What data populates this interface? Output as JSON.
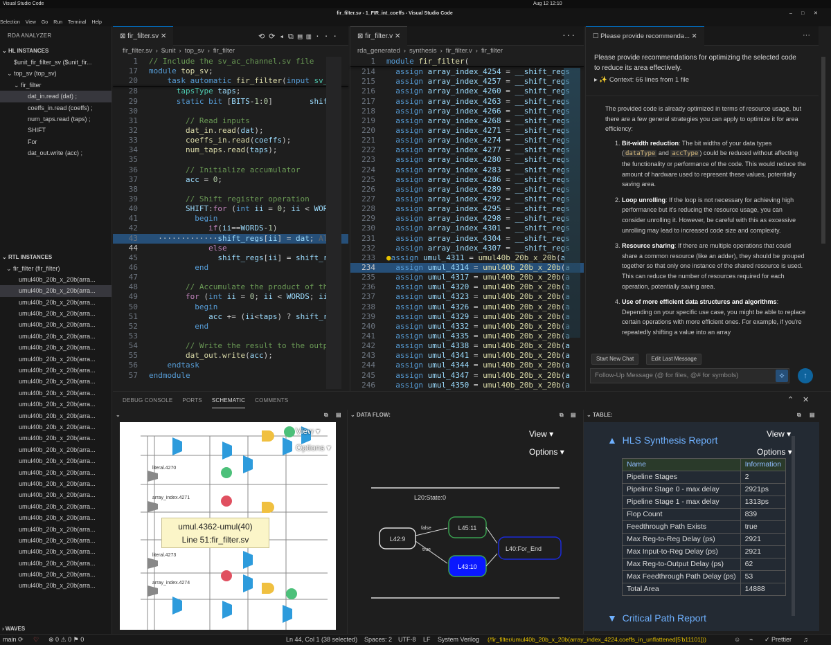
{
  "system_bar": {
    "app": "Visual Studio Code",
    "datetime": "Aug 12  12:10"
  },
  "window": {
    "title": "fir_filter.sv - 1_FIR_int_coeffs - Visual Studio Code"
  },
  "menu": [
    "Selection",
    "View",
    "Go",
    "Run",
    "Terminal",
    "Help"
  ],
  "sidebar": {
    "title": "RDA ANALYZER",
    "hl_section": "HL INSTANCES",
    "hl_items": [
      {
        "label": "$unit_fir_filter_sv ($unit_fir...",
        "indent": 1
      },
      {
        "label": "top_sv (top_sv)",
        "indent": 1
      },
      {
        "label": "fir_filter",
        "indent": 2
      },
      {
        "label": "dat_in.read (dat) ;",
        "indent": 3,
        "selected": true
      },
      {
        "label": "coeffs_in.read (coeffs) ;",
        "indent": 3
      },
      {
        "label": "num_taps.read (taps) ;",
        "indent": 3
      },
      {
        "label": "SHIFT",
        "indent": 3
      },
      {
        "label": "For",
        "indent": 3
      },
      {
        "label": "dat_out.write (acc) ;",
        "indent": 3
      }
    ],
    "rtl_section": "RTL INSTANCES",
    "rtl_root": "fir_filter (fir_filter)",
    "rtl_items": [
      "umul40b_20b_x_20b(arra...",
      "umul40b_20b_x_20b(arra...",
      "umul40b_20b_x_20b(arra...",
      "umul40b_20b_x_20b(arra...",
      "umul40b_20b_x_20b(arra...",
      "umul40b_20b_x_20b(arra...",
      "umul40b_20b_x_20b(arra...",
      "umul40b_20b_x_20b(arra...",
      "umul40b_20b_x_20b(arra...",
      "umul40b_20b_x_20b(arra...",
      "umul40b_20b_x_20b(arra...",
      "umul40b_20b_x_20b(arra...",
      "umul40b_20b_x_20b(arra...",
      "umul40b_20b_x_20b(arra...",
      "umul40b_20b_x_20b(arra...",
      "umul40b_20b_x_20b(arra...",
      "umul40b_20b_x_20b(arra...",
      "umul40b_20b_x_20b(arra...",
      "umul40b_20b_x_20b(arra...",
      "umul40b_20b_x_20b(arra...",
      "umul40b_20b_x_20b(arra...",
      "umul40b_20b_x_20b(arra...",
      "umul40b_20b_x_20b(arra...",
      "umul40b_20b_x_20b(arra...",
      "umul40b_20b_x_20b(arra...",
      "umul40b_20b_x_20b(arra...",
      "umul40b_20b_x_20b(arra...",
      "umul40b_20b_x_20b(arra..."
    ],
    "rtl_selected_index": 1,
    "waves": "WAVES"
  },
  "editor1": {
    "tab": "fir_filter.sv",
    "breadcrumb": [
      "fir_filter.sv",
      "$unit",
      "top_sv",
      "fir_filter"
    ],
    "sticky": [
      {
        "n": "1",
        "html": "<span class='cm'>// Include the sv_ac_channel.sv file</span>"
      },
      {
        "n": "17",
        "html": "<span class='kw'>module</span> <span class='fn'>top_sv</span>;"
      },
      {
        "n": "20",
        "html": "    <span class='kw'>task</span> <span class='kw'>automatic</span> <span class='fn'>fir_filter</span>(<span class='kw'>input</span> <span class='ty'>sv_ac</span>"
      }
    ],
    "lines": [
      {
        "n": "28",
        "html": "      <span class='ty'>tapsType</span> <span class='id'>taps</span>;"
      },
      {
        "n": "29",
        "html": "      <span class='kw'>static</span> <span class='kw'>bit</span> [<span class='id'>BITS</span>-<span class='nm'>1</span>:<span class='nm'>0</span>]        <span class='id'>shift_</span>"
      },
      {
        "n": "30",
        "html": ""
      },
      {
        "n": "31",
        "html": "        <span class='cm'>// Read inputs</span>"
      },
      {
        "n": "32",
        "html": "        <span class='fn'>dat_in</span>.<span class='fn'>read</span>(<span class='id'>dat</span>);"
      },
      {
        "n": "33",
        "html": "        <span class='fn'>coeffs_in</span>.<span class='fn'>read</span>(<span class='id'>coeffs</span>);"
      },
      {
        "n": "34",
        "html": "        <span class='fn'>num_taps</span>.<span class='fn'>read</span>(<span class='id'>taps</span>);"
      },
      {
        "n": "35",
        "html": ""
      },
      {
        "n": "36",
        "html": "        <span class='cm'>// Initialize accumulator</span>"
      },
      {
        "n": "37",
        "html": "        <span class='id'>acc</span> = <span class='nm'>0</span>;"
      },
      {
        "n": "38",
        "html": ""
      },
      {
        "n": "39",
        "html": "        <span class='cm'>// Shift register operation</span>"
      },
      {
        "n": "40",
        "html": "        <span class='id'>SHIFT</span>:<span class='pk'>for</span> (<span class='kw'>int</span> <span class='id'>ii</span> = <span class='nm'>0</span>; <span class='id'>ii</span> &lt; <span class='id'>WORD</span>"
      },
      {
        "n": "41",
        "html": "          <span class='kw'>begin</span>"
      },
      {
        "n": "42",
        "html": "             <span class='pk'>if</span>(<span class='id'>ii</span>==<span class='id'>WORDS</span>-<span class='nm'>1</span>)"
      },
      {
        "n": "43",
        "html": "  ·············<span class='id'>shift_regs</span>[<span class='id'>ii</span>] = <span class='id'>dat</span>; <span style='color:#666'>Al</span>",
        "hl": true
      },
      {
        "n": "44",
        "html": "             <span class='pk'>else</span>",
        "cur": true
      },
      {
        "n": "45",
        "html": "               <span class='id'>shift_regs</span>[<span class='id'>ii</span>] = <span class='id'>shift_re</span>"
      },
      {
        "n": "46",
        "html": "          <span class='kw'>end</span>"
      },
      {
        "n": "47",
        "html": ""
      },
      {
        "n": "48",
        "html": "        <span class='cm'>// Accumulate the product of th</span>"
      },
      {
        "n": "49",
        "html": "        <span class='pk'>for</span> (<span class='kw'>int</span> <span class='id'>ii</span> = <span class='nm'>0</span>; <span class='id'>ii</span> &lt; <span class='id'>WORDS</span>; <span class='id'>ii</span>-"
      },
      {
        "n": "50",
        "html": "          <span class='kw'>begin</span>"
      },
      {
        "n": "51",
        "html": "             <span class='id'>acc</span> += (<span class='id'>ii</span>&lt;<span class='id'>taps</span>) ? <span class='id'>shift_re</span>"
      },
      {
        "n": "52",
        "html": "          <span class='kw'>end</span>"
      },
      {
        "n": "53",
        "html": ""
      },
      {
        "n": "54",
        "html": "        <span class='cm'>// Write the result to the outpu</span>"
      },
      {
        "n": "55",
        "html": "        <span class='fn'>dat_out</span>.<span class='fn'>write</span>(<span class='id'>acc</span>);"
      },
      {
        "n": "56",
        "html": "    <span class='kw'>endtask</span>"
      },
      {
        "n": "57",
        "html": "<span class='kw'>endmodule</span>"
      }
    ]
  },
  "editor2": {
    "tab": "fir_filter.v",
    "breadcrumb": [
      "rda_generated",
      "synthesis",
      "fir_filter.v",
      "fir_filter"
    ],
    "sticky": {
      "n": "1",
      "html": "<span class='kw'>module</span> <span class='fn'>fir_filter</span>("
    },
    "lines": [
      {
        "n": "214",
        "html": "  <span class='kw'>assign</span> <span class='id'>array_index_4254</span> = <span class='id'>__shift_regs</span>"
      },
      {
        "n": "215",
        "html": "  <span class='kw'>assign</span> <span class='id'>array_index_4257</span> = <span class='id'>__shift_regs</span>"
      },
      {
        "n": "216",
        "html": "  <span class='kw'>assign</span> <span class='id'>array_index_4260</span> = <span class='id'>__shift_regs</span>"
      },
      {
        "n": "217",
        "html": "  <span class='kw'>assign</span> <span class='id'>array_index_4263</span> = <span class='id'>__shift_regs</span>"
      },
      {
        "n": "218",
        "html": "  <span class='kw'>assign</span> <span class='id'>array_index_4266</span> = <span class='id'>__shift_regs</span>"
      },
      {
        "n": "219",
        "html": "  <span class='kw'>assign</span> <span class='id'>array_index_4268</span> = <span class='id'>__shift_regs</span>"
      },
      {
        "n": "220",
        "html": "  <span class='kw'>assign</span> <span class='id'>array_index_4271</span> = <span class='id'>__shift_regs</span>"
      },
      {
        "n": "221",
        "html": "  <span class='kw'>assign</span> <span class='id'>array_index_4274</span> = <span class='id'>__shift_regs</span>"
      },
      {
        "n": "222",
        "html": "  <span class='kw'>assign</span> <span class='id'>array_index_4277</span> = <span class='id'>__shift_regs</span>"
      },
      {
        "n": "223",
        "html": "  <span class='kw'>assign</span> <span class='id'>array_index_4280</span> = <span class='id'>__shift_regs</span>"
      },
      {
        "n": "224",
        "html": "  <span class='kw'>assign</span> <span class='id'>array_index_4283</span> = <span class='id'>__shift_regs</span>"
      },
      {
        "n": "225",
        "html": "  <span class='kw'>assign</span> <span class='id'>array_index_4286</span> = <span class='id'>__shift_regs</span>"
      },
      {
        "n": "226",
        "html": "  <span class='kw'>assign</span> <span class='id'>array_index_4289</span> = <span class='id'>__shift_regs</span>"
      },
      {
        "n": "227",
        "html": "  <span class='kw'>assign</span> <span class='id'>array_index_4292</span> = <span class='id'>__shift_regs</span>"
      },
      {
        "n": "228",
        "html": "  <span class='kw'>assign</span> <span class='id'>array_index_4295</span> = <span class='id'>__shift_regs</span>"
      },
      {
        "n": "229",
        "html": "  <span class='kw'>assign</span> <span class='id'>array_index_4298</span> = <span class='id'>__shift_regs</span>"
      },
      {
        "n": "230",
        "html": "  <span class='kw'>assign</span> <span class='id'>array_index_4301</span> = <span class='id'>__shift_regs</span>"
      },
      {
        "n": "231",
        "html": "  <span class='kw'>assign</span> <span class='id'>array_index_4304</span> = <span class='id'>__shift_regs</span>"
      },
      {
        "n": "232",
        "html": "  <span class='kw'>assign</span> <span class='id'>array_index_4307</span> = <span class='id'>__shift_regs</span>"
      },
      {
        "n": "233",
        "html": "<span style='color:#e5c100'>●</span><span class='kw'>assign</span> <span class='id'>umul_4311</span> = <span class='fn'>umul40b_20b_x_20b</span>(<span class='id'>a</span>"
      },
      {
        "n": "234",
        "html": "  <span class='kw'>assign</span> <span class='id'>umul_4314</span> = <span class='fn'>umul40b_20b_x_20b</span>(<span class='id'>a</span>",
        "hl": true,
        "cur": true
      },
      {
        "n": "235",
        "html": "  <span class='kw'>assign</span> <span class='id'>umul_4317</span> = <span class='fn'>umul40b_20b_x_20b</span>(<span class='id'>a</span>"
      },
      {
        "n": "236",
        "html": "  <span class='kw'>assign</span> <span class='id'>umul_4320</span> = <span class='fn'>umul40b_20b_x_20b</span>(<span class='id'>a</span>"
      },
      {
        "n": "237",
        "html": "  <span class='kw'>assign</span> <span class='id'>umul_4323</span> = <span class='fn'>umul40b_20b_x_20b</span>(<span class='id'>a</span>"
      },
      {
        "n": "238",
        "html": "  <span class='kw'>assign</span> <span class='id'>umul_4326</span> = <span class='fn'>umul40b_20b_x_20b</span>(<span class='id'>a</span>"
      },
      {
        "n": "239",
        "html": "  <span class='kw'>assign</span> <span class='id'>umul_4329</span> = <span class='fn'>umul40b_20b_x_20b</span>(<span class='id'>a</span>"
      },
      {
        "n": "240",
        "html": "  <span class='kw'>assign</span> <span class='id'>umul_4332</span> = <span class='fn'>umul40b_20b_x_20b</span>(<span class='id'>a</span>"
      },
      {
        "n": "241",
        "html": "  <span class='kw'>assign</span> <span class='id'>umul_4335</span> = <span class='fn'>umul40b_20b_x_20b</span>(<span class='id'>a</span>"
      },
      {
        "n": "242",
        "html": "  <span class='kw'>assign</span> <span class='id'>umul_4338</span> = <span class='fn'>umul40b_20b_x_20b</span>(<span class='id'>a</span>"
      },
      {
        "n": "243",
        "html": "  <span class='kw'>assign</span> <span class='id'>umul_4341</span> = <span class='fn'>umul40b_20b_x_20b</span>(<span class='id'>a</span>"
      },
      {
        "n": "244",
        "html": "  <span class='kw'>assign</span> <span class='id'>umul_4344</span> = <span class='fn'>umul40b_20b_x_20b</span>(<span class='id'>a</span>"
      },
      {
        "n": "245",
        "html": "  <span class='kw'>assign</span> <span class='id'>umul_4347</span> = <span class='fn'>umul40b_20b_x_20b</span>(<span class='id'>a</span>"
      },
      {
        "n": "246",
        "html": "  <span class='kw'>assign</span> <span class='id'>umul_4350</span> = <span class='fn'>umul40b_20b_x_20b</span>(<span class='id'>a</span>"
      }
    ]
  },
  "chat": {
    "tab": "Please provide recommenda...",
    "prompt": "Please provide recommendations for optimizing the selected code to reduce its area effectively.",
    "context": "✨ Context: 66 lines from 1 file",
    "intro": "The provided code is already optimized in terms of resource usage, but there are a few general strategies you can apply to optimize it for area efficiency:",
    "items": [
      {
        "title": "Bit-width reduction",
        "html": ": The bit widths of your data types (<span class='code'>dataType</span> and <span class='code'>accType</span>) could be reduced without affecting the functionality or performance of the code. This would reduce the amount of hardware used to represent these values, potentially saving area."
      },
      {
        "title": "Loop unrolling",
        "html": ": If the loop is not necessary for achieving high performance but it's reducing the resource usage, you can consider unrolling it. However, be careful with this as excessive unrolling may lead to increased code size and complexity."
      },
      {
        "title": "Resource sharing",
        "html": ": If there are multiple operations that could share a common resource (like an adder), they should be grouped together so that only one instance of the shared resource is used. This can reduce the number of resources required for each operation, potentially saving area."
      },
      {
        "title": "Use of more efficient data structures and algorithms",
        "html": ": Depending on your specific use case, you might be able to replace certain operations with more efficient ones. For example, if you're repeatedly shifting a value into an array"
      }
    ],
    "btn_new": "Start New Chat",
    "btn_edit": "Edit Last Message",
    "input_placeholder": "Follow-Up Message (@ for files, @# for symbols)"
  },
  "panel": {
    "tabs": [
      "DEBUG CONSOLE",
      "PORTS",
      "SCHEMATIC",
      "COMMENTS"
    ],
    "active_tab": "SCHEMATIC",
    "schematic": {
      "view": "View",
      "options": "Options",
      "labels": [
        "literal.4270",
        "array_index.4271",
        "literal.4273",
        "array_index.4274"
      ],
      "tooltip_line1": "umul.4362-umul(40)",
      "tooltip_line2": "Line 51:fir_filter.sv"
    },
    "dataflow": {
      "header": "DATA FLOW:",
      "view": "View",
      "options": "Options",
      "state": "L20:State:0",
      "nodes": {
        "start": "L42:9",
        "top": "L45:11",
        "bottom": "L43:10",
        "end": "L40:For_End"
      },
      "edge_false": "false",
      "edge_true": "true"
    },
    "table": {
      "header": "TABLE:",
      "view": "View",
      "options": "Options",
      "report_title": "HLS Synthesis Report",
      "col_name": "Name",
      "col_info": "Information",
      "rows": [
        [
          "Pipeline Stages",
          "2"
        ],
        [
          "Pipeline Stage 0 - max delay",
          "2921ps"
        ],
        [
          "Pipeline Stage 1 - max delay",
          "1313ps"
        ],
        [
          "Flop Count",
          "839"
        ],
        [
          "Feedthrough Path Exists",
          "true"
        ],
        [
          "Max Reg-to-Reg Delay (ps)",
          "2921"
        ],
        [
          "Max Input-to-Reg Delay (ps)",
          "2921"
        ],
        [
          "Max Reg-to-Output Delay (ps)",
          "62"
        ],
        [
          "Max Feedthrough Path Delay (ps)",
          "53"
        ],
        [
          "Total Area",
          "14888"
        ]
      ],
      "critical_title": "Critical Path Report"
    }
  },
  "status": {
    "branch": "main",
    "errors": "0",
    "warnings": "0",
    "info": "0",
    "position": "Ln 44, Col 1 (38 selected)",
    "spaces": "Spaces: 2",
    "encoding": "UTF-8",
    "eol": "LF",
    "language": "System Verilog",
    "path": "(/fir_filter/umul40b_20b_x_20b(array_index_4224,coeffs_in_unflattened[5'b11101]))",
    "prettier": "Prettier"
  }
}
